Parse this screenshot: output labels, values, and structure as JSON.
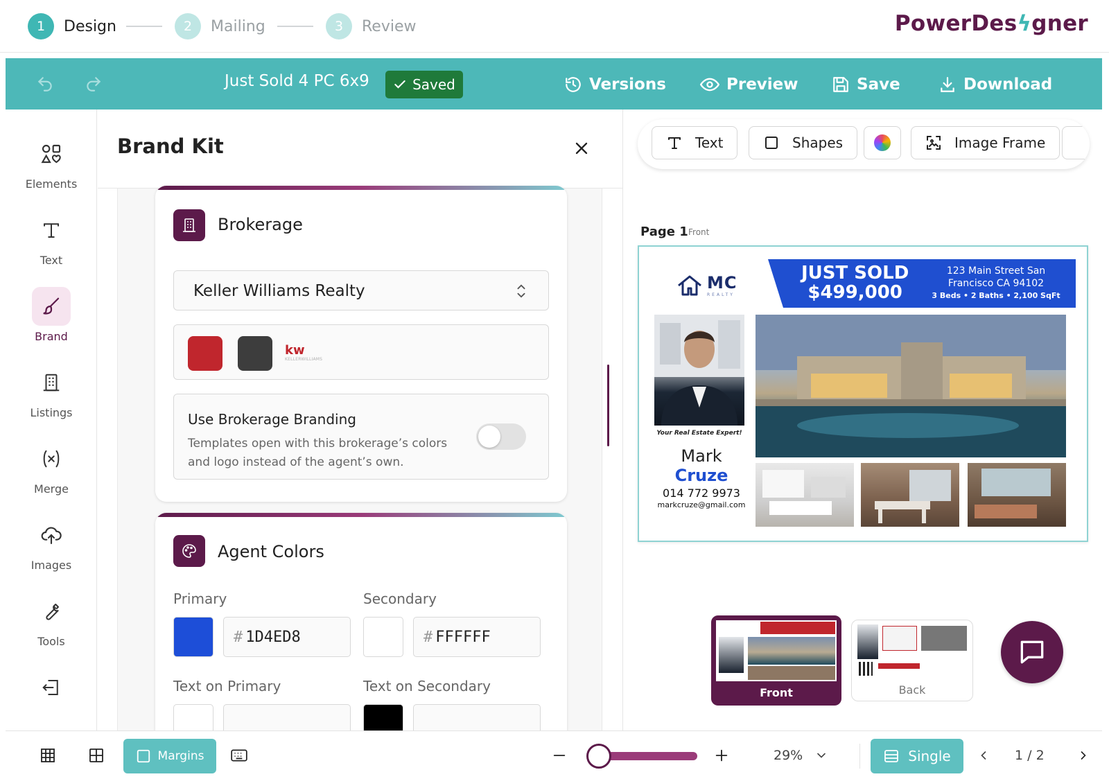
{
  "stepper": {
    "steps": [
      {
        "num": "1",
        "label": "Design"
      },
      {
        "num": "2",
        "label": "Mailing"
      },
      {
        "num": "3",
        "label": "Review"
      }
    ],
    "logo_pre": "PowerDes",
    "logo_bolt": "ϟ",
    "logo_post": "gner"
  },
  "toolbar": {
    "doc_title": "Just Sold 4 PC 6x9",
    "saved_label": "Saved",
    "versions_label": "Versions",
    "preview_label": "Preview",
    "save_label": "Save",
    "download_label": "Download"
  },
  "rail": {
    "items": [
      {
        "label": "Elements"
      },
      {
        "label": "Text"
      },
      {
        "label": "Brand"
      },
      {
        "label": "Listings"
      },
      {
        "label": "Merge"
      },
      {
        "label": "Images"
      },
      {
        "label": "Tools"
      }
    ]
  },
  "panel": {
    "title": "Brand Kit",
    "brokerage": {
      "title": "Brokerage",
      "selected": "Keller Williams Realty",
      "colors": [
        "#c0262d",
        "#3d3d3d"
      ],
      "logo_mark": "kw",
      "logo_sub": "KELLERWILLIAMS",
      "toggle_title": "Use Brokerage Branding",
      "toggle_desc": "Templates open with this brokerage’s colors and logo instead of the agent’s own.",
      "toggle_on": false
    },
    "agent_colors": {
      "title": "Agent Colors",
      "primary_label": "Primary",
      "primary_hex": "1D4ED8",
      "secondary_label": "Secondary",
      "secondary_hex": "FFFFFF",
      "text_primary_label": "Text on Primary",
      "text_secondary_label": "Text on Secondary",
      "hash": "#"
    }
  },
  "canvas": {
    "elements_bar": {
      "text_label": "Text",
      "shapes_label": "Shapes",
      "image_frame_label": "Image Frame"
    },
    "page_label": "Page 1",
    "page_side": "Front",
    "postcard": {
      "logo_text": "MC",
      "logo_sub": "REALTY",
      "headline": "JUST SOLD",
      "price": "$499,000",
      "address_line1": "123 Main Street San",
      "address_line2": "Francisco CA 94102",
      "details": "3 Beds • 2 Baths • 2,100 SqFt",
      "tagline": "Your Real Estate Expert!",
      "agent_first": "Mark",
      "agent_last": "Cruze",
      "phone": "014 772 9973",
      "email": "markcruze@gmail.com"
    },
    "thumbs": [
      {
        "label": "Front"
      },
      {
        "label": "Back"
      }
    ]
  },
  "bottombar": {
    "margins_label": "Margins",
    "zoom": "29%",
    "zoom_fraction": 0.15,
    "view_label": "Single",
    "pager": "1 / 2"
  },
  "colors": {
    "teal": "#4db8b8",
    "plum": "#5c1a4a",
    "saved_green": "#1f7a3a",
    "primary_blue": "#1d4ed8"
  }
}
